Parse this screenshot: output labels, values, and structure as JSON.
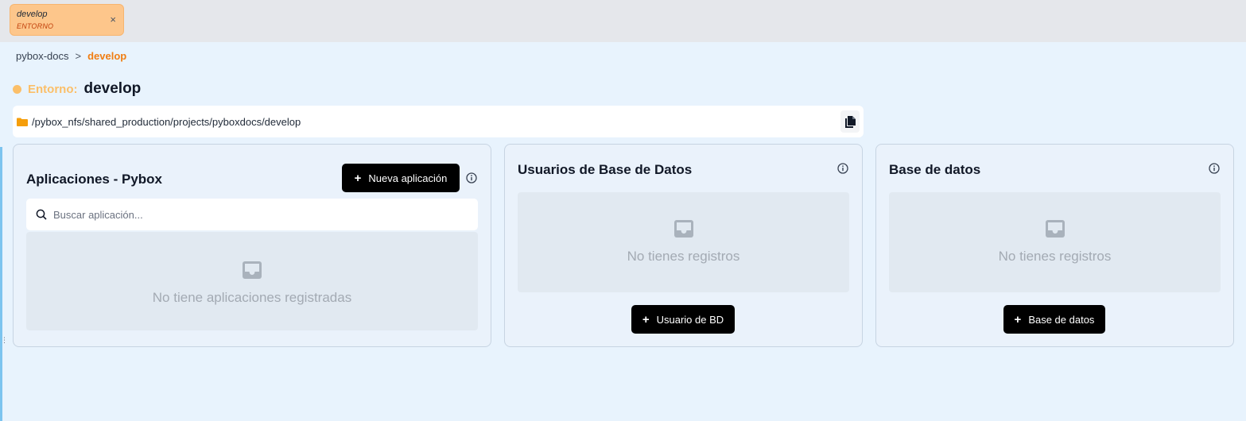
{
  "env_tab": {
    "name": "develop",
    "kind": "ENTORNO",
    "close": "×"
  },
  "breadcrumb": {
    "project": "pybox-docs",
    "separator": ">",
    "current": "develop"
  },
  "environment": {
    "label": "Entorno:",
    "value": "develop"
  },
  "path": {
    "text": "/pybox_nfs/shared_production/projects/pyboxdocs/develop"
  },
  "apps_card": {
    "title": "Aplicaciones - Pybox",
    "new_button": "Nueva aplicación",
    "search_placeholder": "Buscar aplicación...",
    "empty_message": "No tiene aplicaciones registradas"
  },
  "db_users_card": {
    "title": "Usuarios de Base de Datos",
    "empty_message": "No tienes registros",
    "add_button": "Usuario de BD"
  },
  "databases_card": {
    "title": "Base de datos",
    "empty_message": "No tienes registros",
    "add_button": "Base de datos"
  },
  "colors": {
    "accent_orange": "#f07d12",
    "env_yellow": "#fbbf69",
    "button_dark": "#000000",
    "background": "#e8f3fd"
  },
  "icons": {
    "close": "close-icon",
    "folder": "folder-icon",
    "copy": "copy-icon",
    "info": "info-icon",
    "search": "search-icon",
    "plus": "plus-icon",
    "inbox": "inbox-icon"
  }
}
